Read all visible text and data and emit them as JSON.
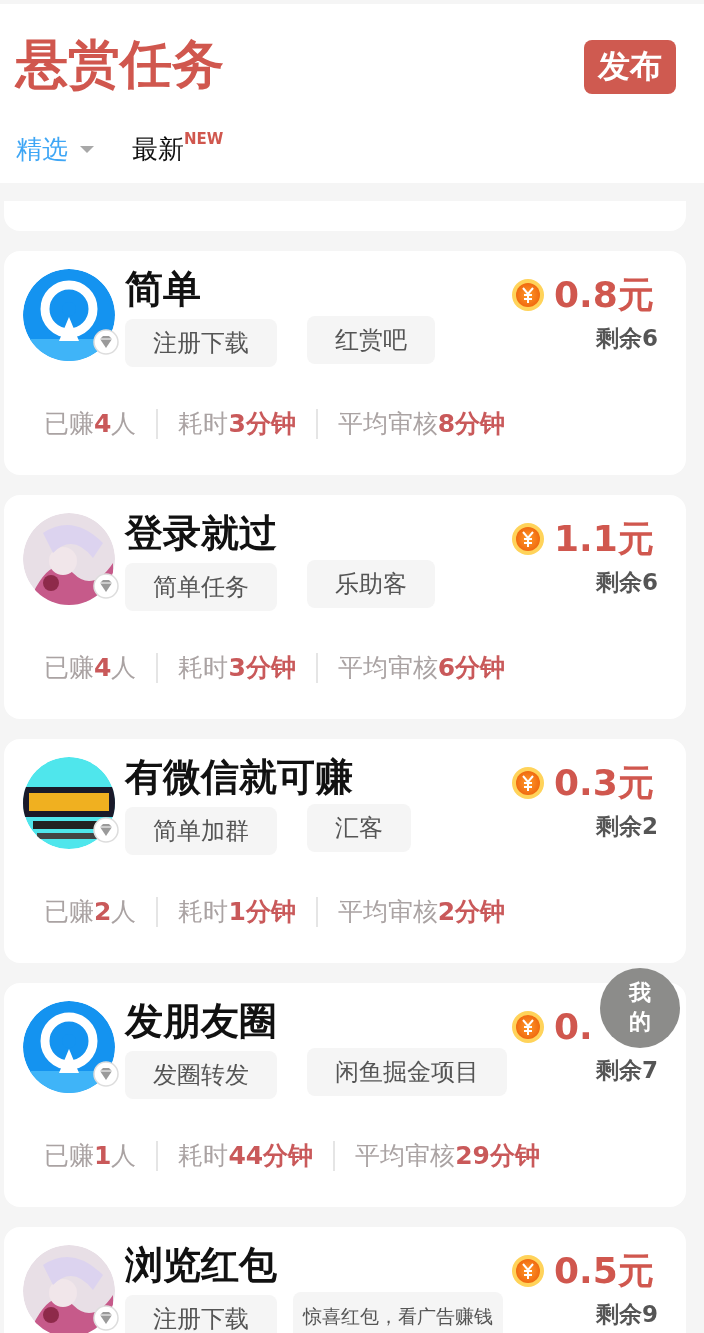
{
  "header": {
    "title": "悬赏任务",
    "publish_button": "发布"
  },
  "tabs": [
    {
      "label": "精选",
      "selected": true,
      "dropdown": true
    },
    {
      "label": "最新",
      "selected": false,
      "badge": "NEW"
    }
  ],
  "tasks": [
    {
      "kind": "partial"
    },
    {
      "kind": "task",
      "avatar": {
        "kind": "picture"
      },
      "title": "简单",
      "tags": [
        "注册下载",
        "红赏吧"
      ],
      "price": "0.8元",
      "remaining": "剩余6",
      "stats": [
        "已赚**4**人",
        "耗时**3分钟**",
        "平均审核**8分钟**"
      ]
    },
    {
      "kind": "task",
      "avatar": {
        "kind": "picture"
      },
      "title": "登录就过",
      "tags": [
        "简单任务",
        "乐助客"
      ],
      "price": "1.1元",
      "remaining": "剩余6",
      "stats": [
        "已赚**4**人",
        "耗时**3分钟**",
        "平均审核**6分钟**"
      ]
    },
    {
      "kind": "task",
      "avatar": {
        "kind": "picture"
      },
      "title": "有微信就可赚",
      "tags": [
        "简单加群",
        "汇客"
      ],
      "price": "0.3元",
      "remaining": "剩余2",
      "stats": [
        "已赚**2**人",
        "耗时**1分钟**",
        "平均审核**2分钟**"
      ]
    },
    {
      "kind": "task",
      "avatar": {
        "kind": "picture"
      },
      "title": "发朋友圈",
      "tags": [
        "发圈转发",
        "闲鱼掘金项目"
      ],
      "price": "0.",
      "remaining": "剩余7",
      "stats": [
        "已赚**1**人",
        "耗时**44分钟**",
        "平均审核**29分钟**"
      ]
    },
    {
      "kind": "task",
      "avatar": {
        "kind": "picture"
      },
      "title": "浏览红包",
      "tags": [
        "注册下载",
        "惊喜红包，看广告赚钱"
      ],
      "price": "0.5元",
      "remaining": "剩余9"
    }
  ],
  "float_button": "我的"
}
